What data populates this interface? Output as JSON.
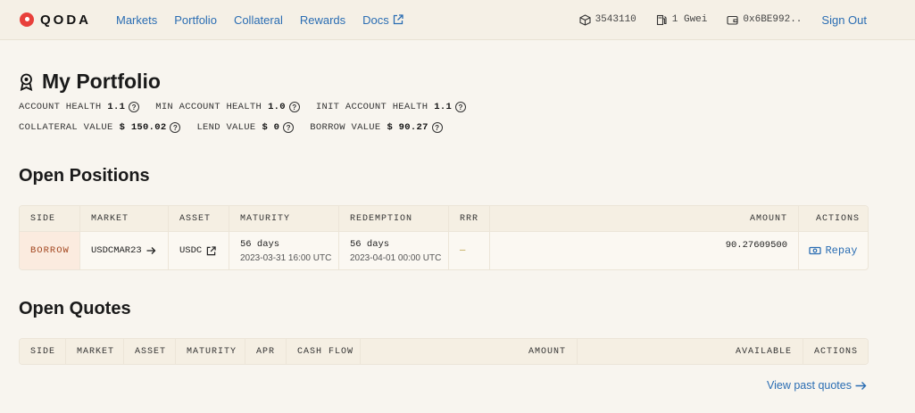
{
  "app": {
    "logo": "QODA"
  },
  "nav": {
    "markets": "Markets",
    "portfolio": "Portfolio",
    "collateral": "Collateral",
    "rewards": "Rewards",
    "docs": "Docs"
  },
  "header": {
    "block": "3543110",
    "gas": "1 Gwei",
    "wallet": "0x6BE992..",
    "sign_out": "Sign Out"
  },
  "portfolio": {
    "title": "My Portfolio",
    "account_health_label": "ACCOUNT HEALTH",
    "account_health": "1.1",
    "min_health_label": "MIN ACCOUNT HEALTH",
    "min_health": "1.0",
    "init_health_label": "INIT ACCOUNT HEALTH",
    "init_health": "1.1",
    "collateral_label": "COLLATERAL VALUE",
    "collateral": "$ 150.02",
    "lend_label": "LEND VALUE",
    "lend": "$ 0",
    "borrow_label": "BORROW VALUE",
    "borrow": "$ 90.27"
  },
  "open_positions": {
    "title": "Open Positions",
    "columns": [
      "SIDE",
      "MARKET",
      "ASSET",
      "MATURITY",
      "REDEMPTION",
      "RRR",
      "AMOUNT",
      "ACTIONS"
    ],
    "rows": [
      {
        "side": "BORROW",
        "market": "USDCMAR23",
        "asset": "USDC",
        "maturity": "56 days",
        "maturity_date": "2023-03-31 16:00 UTC",
        "redemption": "56 days",
        "redemption_date": "2023-04-01 00:00 UTC",
        "rrr": "—",
        "amount": "90.27609500",
        "action": "Repay"
      }
    ]
  },
  "open_quotes": {
    "title": "Open Quotes",
    "columns": [
      "SIDE",
      "MARKET",
      "ASSET",
      "MATURITY",
      "APR",
      "CASH FLOW",
      "AMOUNT",
      "AVAILABLE",
      "ACTIONS"
    ],
    "view_past": "View past quotes"
  },
  "colors": {
    "accent": "#2a6db3",
    "brand": "#e8403b",
    "borrow": "#a2461f"
  }
}
